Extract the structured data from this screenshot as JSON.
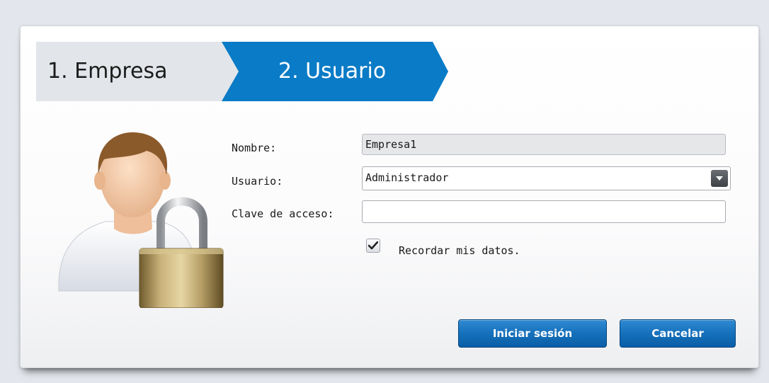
{
  "steps": [
    {
      "label": "1. Empresa",
      "active": false
    },
    {
      "label": "2. Usuario",
      "active": true
    }
  ],
  "colors": {
    "active_step": "#0a7bc6",
    "inactive_step": "#e2e5ea",
    "button": "#1670bb"
  },
  "form": {
    "nombre_label": "Nombre:",
    "nombre_value": "Empresa1",
    "usuario_label": "Usuario:",
    "usuario_value": "Administrador",
    "clave_label": "Clave de acceso:",
    "clave_value": "",
    "remember_label": "Recordar mis datos.",
    "remember_checked": true
  },
  "buttons": {
    "login": "Iniciar sesión",
    "cancel": "Cancelar"
  },
  "icons": {
    "user": "user-avatar-icon",
    "lock": "padlock-icon",
    "dropdown": "chevron-down-icon",
    "check": "checkmark-icon"
  }
}
